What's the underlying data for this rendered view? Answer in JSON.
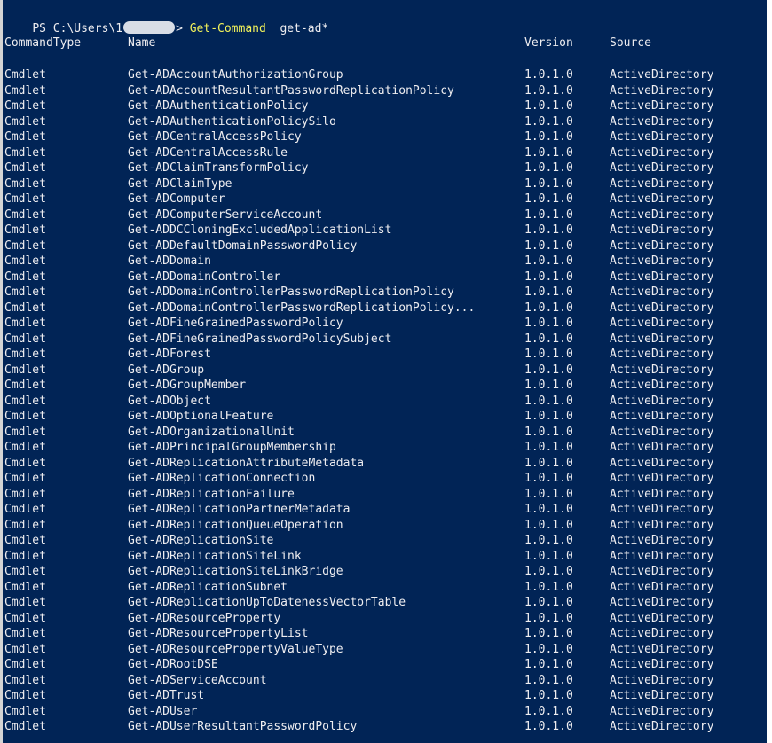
{
  "prompt": {
    "prefix": "PS C:\\Users\\1",
    "suffix": "> ",
    "command": "Get-Command",
    "argument": "  get-ad*"
  },
  "columns": {
    "type": "CommandType",
    "name": "Name",
    "version": "Version",
    "source": "Source"
  },
  "rows": [
    {
      "type": "Cmdlet",
      "name": "Get-ADAccountAuthorizationGroup",
      "version": "1.0.1.0",
      "source": "ActiveDirectory"
    },
    {
      "type": "Cmdlet",
      "name": "Get-ADAccountResultantPasswordReplicationPolicy",
      "version": "1.0.1.0",
      "source": "ActiveDirectory"
    },
    {
      "type": "Cmdlet",
      "name": "Get-ADAuthenticationPolicy",
      "version": "1.0.1.0",
      "source": "ActiveDirectory"
    },
    {
      "type": "Cmdlet",
      "name": "Get-ADAuthenticationPolicySilo",
      "version": "1.0.1.0",
      "source": "ActiveDirectory"
    },
    {
      "type": "Cmdlet",
      "name": "Get-ADCentralAccessPolicy",
      "version": "1.0.1.0",
      "source": "ActiveDirectory"
    },
    {
      "type": "Cmdlet",
      "name": "Get-ADCentralAccessRule",
      "version": "1.0.1.0",
      "source": "ActiveDirectory"
    },
    {
      "type": "Cmdlet",
      "name": "Get-ADClaimTransformPolicy",
      "version": "1.0.1.0",
      "source": "ActiveDirectory"
    },
    {
      "type": "Cmdlet",
      "name": "Get-ADClaimType",
      "version": "1.0.1.0",
      "source": "ActiveDirectory"
    },
    {
      "type": "Cmdlet",
      "name": "Get-ADComputer",
      "version": "1.0.1.0",
      "source": "ActiveDirectory"
    },
    {
      "type": "Cmdlet",
      "name": "Get-ADComputerServiceAccount",
      "version": "1.0.1.0",
      "source": "ActiveDirectory"
    },
    {
      "type": "Cmdlet",
      "name": "Get-ADDCCloningExcludedApplicationList",
      "version": "1.0.1.0",
      "source": "ActiveDirectory"
    },
    {
      "type": "Cmdlet",
      "name": "Get-ADDefaultDomainPasswordPolicy",
      "version": "1.0.1.0",
      "source": "ActiveDirectory"
    },
    {
      "type": "Cmdlet",
      "name": "Get-ADDomain",
      "version": "1.0.1.0",
      "source": "ActiveDirectory"
    },
    {
      "type": "Cmdlet",
      "name": "Get-ADDomainController",
      "version": "1.0.1.0",
      "source": "ActiveDirectory"
    },
    {
      "type": "Cmdlet",
      "name": "Get-ADDomainControllerPasswordReplicationPolicy",
      "version": "1.0.1.0",
      "source": "ActiveDirectory"
    },
    {
      "type": "Cmdlet",
      "name": "Get-ADDomainControllerPasswordReplicationPolicy...",
      "version": "1.0.1.0",
      "source": "ActiveDirectory"
    },
    {
      "type": "Cmdlet",
      "name": "Get-ADFineGrainedPasswordPolicy",
      "version": "1.0.1.0",
      "source": "ActiveDirectory"
    },
    {
      "type": "Cmdlet",
      "name": "Get-ADFineGrainedPasswordPolicySubject",
      "version": "1.0.1.0",
      "source": "ActiveDirectory"
    },
    {
      "type": "Cmdlet",
      "name": "Get-ADForest",
      "version": "1.0.1.0",
      "source": "ActiveDirectory"
    },
    {
      "type": "Cmdlet",
      "name": "Get-ADGroup",
      "version": "1.0.1.0",
      "source": "ActiveDirectory"
    },
    {
      "type": "Cmdlet",
      "name": "Get-ADGroupMember",
      "version": "1.0.1.0",
      "source": "ActiveDirectory"
    },
    {
      "type": "Cmdlet",
      "name": "Get-ADObject",
      "version": "1.0.1.0",
      "source": "ActiveDirectory"
    },
    {
      "type": "Cmdlet",
      "name": "Get-ADOptionalFeature",
      "version": "1.0.1.0",
      "source": "ActiveDirectory"
    },
    {
      "type": "Cmdlet",
      "name": "Get-ADOrganizationalUnit",
      "version": "1.0.1.0",
      "source": "ActiveDirectory"
    },
    {
      "type": "Cmdlet",
      "name": "Get-ADPrincipalGroupMembership",
      "version": "1.0.1.0",
      "source": "ActiveDirectory"
    },
    {
      "type": "Cmdlet",
      "name": "Get-ADReplicationAttributeMetadata",
      "version": "1.0.1.0",
      "source": "ActiveDirectory"
    },
    {
      "type": "Cmdlet",
      "name": "Get-ADReplicationConnection",
      "version": "1.0.1.0",
      "source": "ActiveDirectory"
    },
    {
      "type": "Cmdlet",
      "name": "Get-ADReplicationFailure",
      "version": "1.0.1.0",
      "source": "ActiveDirectory"
    },
    {
      "type": "Cmdlet",
      "name": "Get-ADReplicationPartnerMetadata",
      "version": "1.0.1.0",
      "source": "ActiveDirectory"
    },
    {
      "type": "Cmdlet",
      "name": "Get-ADReplicationQueueOperation",
      "version": "1.0.1.0",
      "source": "ActiveDirectory"
    },
    {
      "type": "Cmdlet",
      "name": "Get-ADReplicationSite",
      "version": "1.0.1.0",
      "source": "ActiveDirectory"
    },
    {
      "type": "Cmdlet",
      "name": "Get-ADReplicationSiteLink",
      "version": "1.0.1.0",
      "source": "ActiveDirectory"
    },
    {
      "type": "Cmdlet",
      "name": "Get-ADReplicationSiteLinkBridge",
      "version": "1.0.1.0",
      "source": "ActiveDirectory"
    },
    {
      "type": "Cmdlet",
      "name": "Get-ADReplicationSubnet",
      "version": "1.0.1.0",
      "source": "ActiveDirectory"
    },
    {
      "type": "Cmdlet",
      "name": "Get-ADReplicationUpToDatenessVectorTable",
      "version": "1.0.1.0",
      "source": "ActiveDirectory"
    },
    {
      "type": "Cmdlet",
      "name": "Get-ADResourceProperty",
      "version": "1.0.1.0",
      "source": "ActiveDirectory"
    },
    {
      "type": "Cmdlet",
      "name": "Get-ADResourcePropertyList",
      "version": "1.0.1.0",
      "source": "ActiveDirectory"
    },
    {
      "type": "Cmdlet",
      "name": "Get-ADResourcePropertyValueType",
      "version": "1.0.1.0",
      "source": "ActiveDirectory"
    },
    {
      "type": "Cmdlet",
      "name": "Get-ADRootDSE",
      "version": "1.0.1.0",
      "source": "ActiveDirectory"
    },
    {
      "type": "Cmdlet",
      "name": "Get-ADServiceAccount",
      "version": "1.0.1.0",
      "source": "ActiveDirectory"
    },
    {
      "type": "Cmdlet",
      "name": "Get-ADTrust",
      "version": "1.0.1.0",
      "source": "ActiveDirectory"
    },
    {
      "type": "Cmdlet",
      "name": "Get-ADUser",
      "version": "1.0.1.0",
      "source": "ActiveDirectory"
    },
    {
      "type": "Cmdlet",
      "name": "Get-ADUserResultantPasswordPolicy",
      "version": "1.0.1.0",
      "source": "ActiveDirectory"
    }
  ]
}
